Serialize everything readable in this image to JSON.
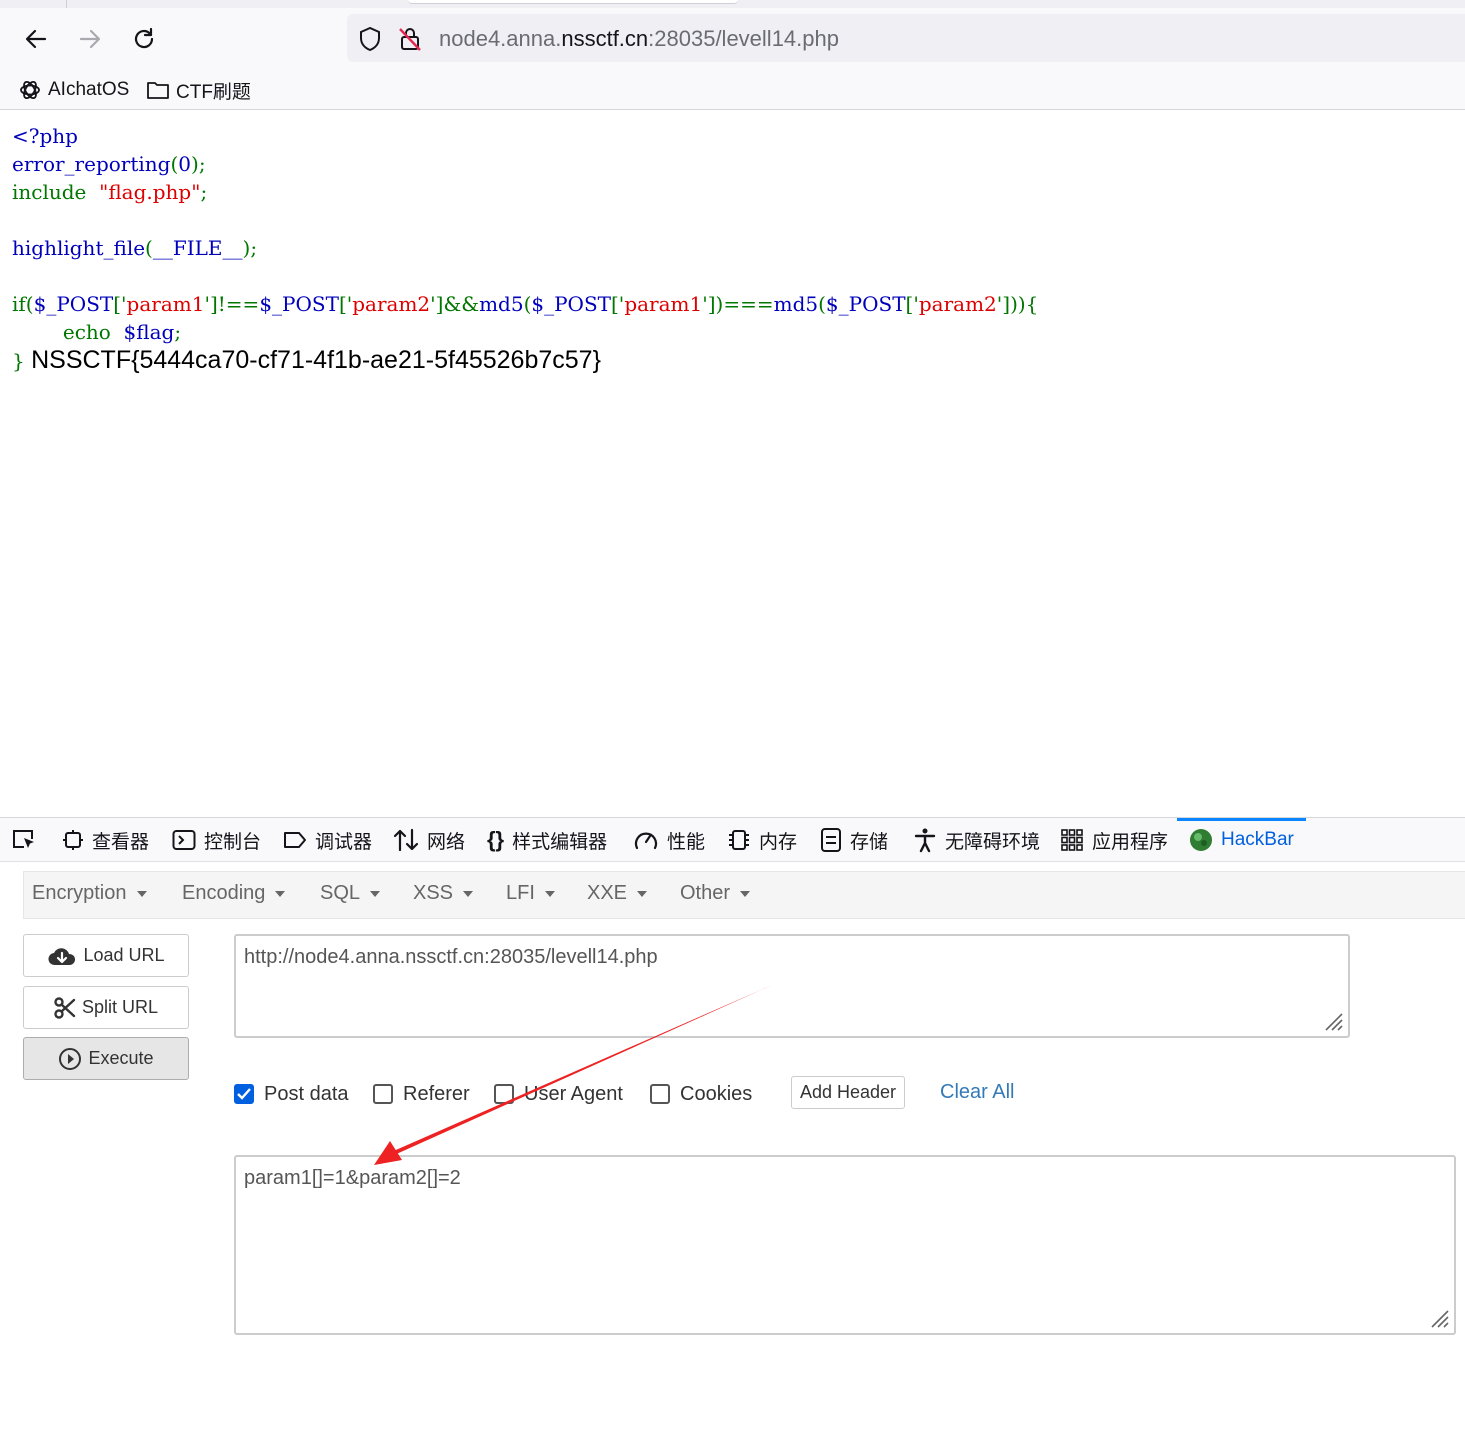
{
  "browser": {
    "url_prefix": "node4.anna.",
    "url_domain": "nssctf.cn",
    "url_suffix": ":28035/levell14.php",
    "bookmarks": [
      {
        "label": "AIchatOS",
        "icon": "openai-icon"
      },
      {
        "label": "CTF刷题",
        "icon": "folder-icon"
      }
    ]
  },
  "page": {
    "line1": "<?php",
    "line2_fn": "error_reporting",
    "line2_open": "(",
    "line2_arg": "0",
    "line2_close": ");",
    "line3_kw": "include",
    "line3_str": "\"flag.php\"",
    "line3_end": ";",
    "line5_fn": "highlight_file",
    "line5_open": "(",
    "line5_arg": "__FILE__",
    "line5_close": ");",
    "line7_if": "if(",
    "line7_a": "$_POST",
    "line7_b": "['",
    "line7_c": "param1",
    "line7_d": "']!==",
    "line7_e": "$_POST",
    "line7_f": "['",
    "line7_g": "param2",
    "line7_h": "']&&",
    "line7_i": "md5",
    "line7_j": "(",
    "line7_k": "$_POST",
    "line7_l": "['",
    "line7_m": "param1",
    "line7_n": "'])===",
    "line7_o": "md5",
    "line7_p": "(",
    "line7_q": "$_POST",
    "line7_r": "['",
    "line7_s": "param2",
    "line7_t": "'])){",
    "line8_kw": "echo",
    "line8_var": "$flag",
    "line8_end": ";",
    "line9_brace": "}",
    "flag_output": "NSSCTF{5444ca70-cf71-4f1b-ae21-5f45526b7c57}"
  },
  "devtools": {
    "tabs": [
      {
        "label": "查看器",
        "icon": "inspector-icon"
      },
      {
        "label": "控制台",
        "icon": "console-icon"
      },
      {
        "label": "调试器",
        "icon": "debugger-icon"
      },
      {
        "label": "网络",
        "icon": "network-icon"
      },
      {
        "label": "样式编辑器",
        "icon": "style-editor-icon"
      },
      {
        "label": "性能",
        "icon": "performance-icon"
      },
      {
        "label": "内存",
        "icon": "memory-icon"
      },
      {
        "label": "存储",
        "icon": "storage-icon"
      },
      {
        "label": "无障碍环境",
        "icon": "accessibility-icon"
      },
      {
        "label": "应用程序",
        "icon": "application-icon"
      },
      {
        "label": "HackBar",
        "icon": "hackbar-icon"
      }
    ],
    "active_tab": "HackBar"
  },
  "hackbar": {
    "menus": [
      "Encryption",
      "Encoding",
      "SQL",
      "XSS",
      "LFI",
      "XXE",
      "Other"
    ],
    "load_url": "Load URL",
    "split_url": "Split URL",
    "execute": "Execute",
    "url_value": "http://node4.anna.nssctf.cn:28035/levell14.php",
    "options": [
      {
        "label": "Post data",
        "checked": true
      },
      {
        "label": "Referer",
        "checked": false
      },
      {
        "label": "User Agent",
        "checked": false
      },
      {
        "label": "Cookies",
        "checked": false
      }
    ],
    "add_header": "Add Header",
    "clear_all": "Clear All",
    "post_value": "param1[]=1&param2[]=2"
  },
  "colors": {
    "php_default": "#0000bb",
    "php_keyword": "#007700",
    "php_string": "#dd0000",
    "accent": "#0060df",
    "annotation_arrow": "#ee2222"
  }
}
